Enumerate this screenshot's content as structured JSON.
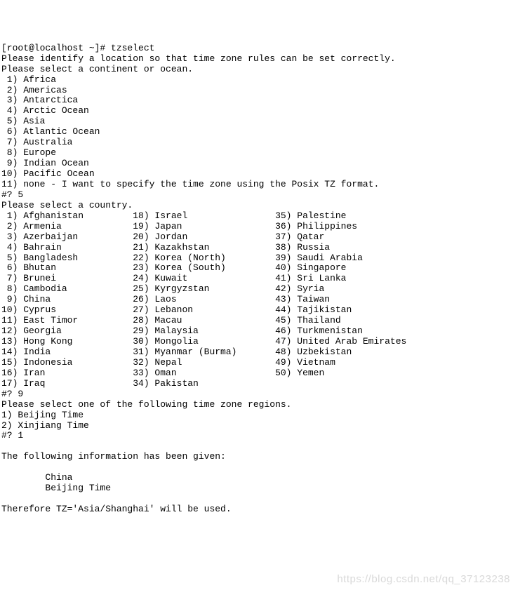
{
  "prompt_line": "[root@localhost ~]# tzselect",
  "intro": {
    "line1": "Please identify a location so that time zone rules can be set correctly.",
    "line2": "Please select a continent or ocean."
  },
  "continents": [
    " 1) Africa",
    " 2) Americas",
    " 3) Antarctica",
    " 4) Arctic Ocean",
    " 5) Asia",
    " 6) Atlantic Ocean",
    " 7) Australia",
    " 8) Europe",
    " 9) Indian Ocean",
    "10) Pacific Ocean",
    "11) none - I want to specify the time zone using the Posix TZ format."
  ],
  "answer1": "#? 5",
  "country_prompt": "Please select a country.",
  "countries": {
    "col1": [
      " 1) Afghanistan",
      " 2) Armenia",
      " 3) Azerbaijan",
      " 4) Bahrain",
      " 5) Bangladesh",
      " 6) Bhutan",
      " 7) Brunei",
      " 8) Cambodia",
      " 9) China",
      "10) Cyprus",
      "11) East Timor",
      "12) Georgia",
      "13) Hong Kong",
      "14) India",
      "15) Indonesia",
      "16) Iran",
      "17) Iraq"
    ],
    "col2": [
      "18) Israel",
      "19) Japan",
      "20) Jordan",
      "21) Kazakhstan",
      "22) Korea (North)",
      "23) Korea (South)",
      "24) Kuwait",
      "25) Kyrgyzstan",
      "26) Laos",
      "27) Lebanon",
      "28) Macau",
      "29) Malaysia",
      "30) Mongolia",
      "31) Myanmar (Burma)",
      "32) Nepal",
      "33) Oman",
      "34) Pakistan"
    ],
    "col3": [
      "35) Palestine",
      "36) Philippines",
      "37) Qatar",
      "38) Russia",
      "39) Saudi Arabia",
      "40) Singapore",
      "41) Sri Lanka",
      "42) Syria",
      "43) Taiwan",
      "44) Tajikistan",
      "45) Thailand",
      "46) Turkmenistan",
      "47) United Arab Emirates",
      "48) Uzbekistan",
      "49) Vietnam",
      "50) Yemen",
      ""
    ]
  },
  "answer2": "#? 9",
  "region_prompt": "Please select one of the following time zone regions.",
  "regions": [
    "1) Beijing Time",
    "2) Xinjiang Time"
  ],
  "answer3": "#? 1",
  "confirm": {
    "line1": "The following information has been given:",
    "line2": "        China",
    "line3": "        Beijing Time",
    "line4": "Therefore TZ='Asia/Shanghai' will be used."
  },
  "watermark": "https://blog.csdn.net/qq_37123238"
}
